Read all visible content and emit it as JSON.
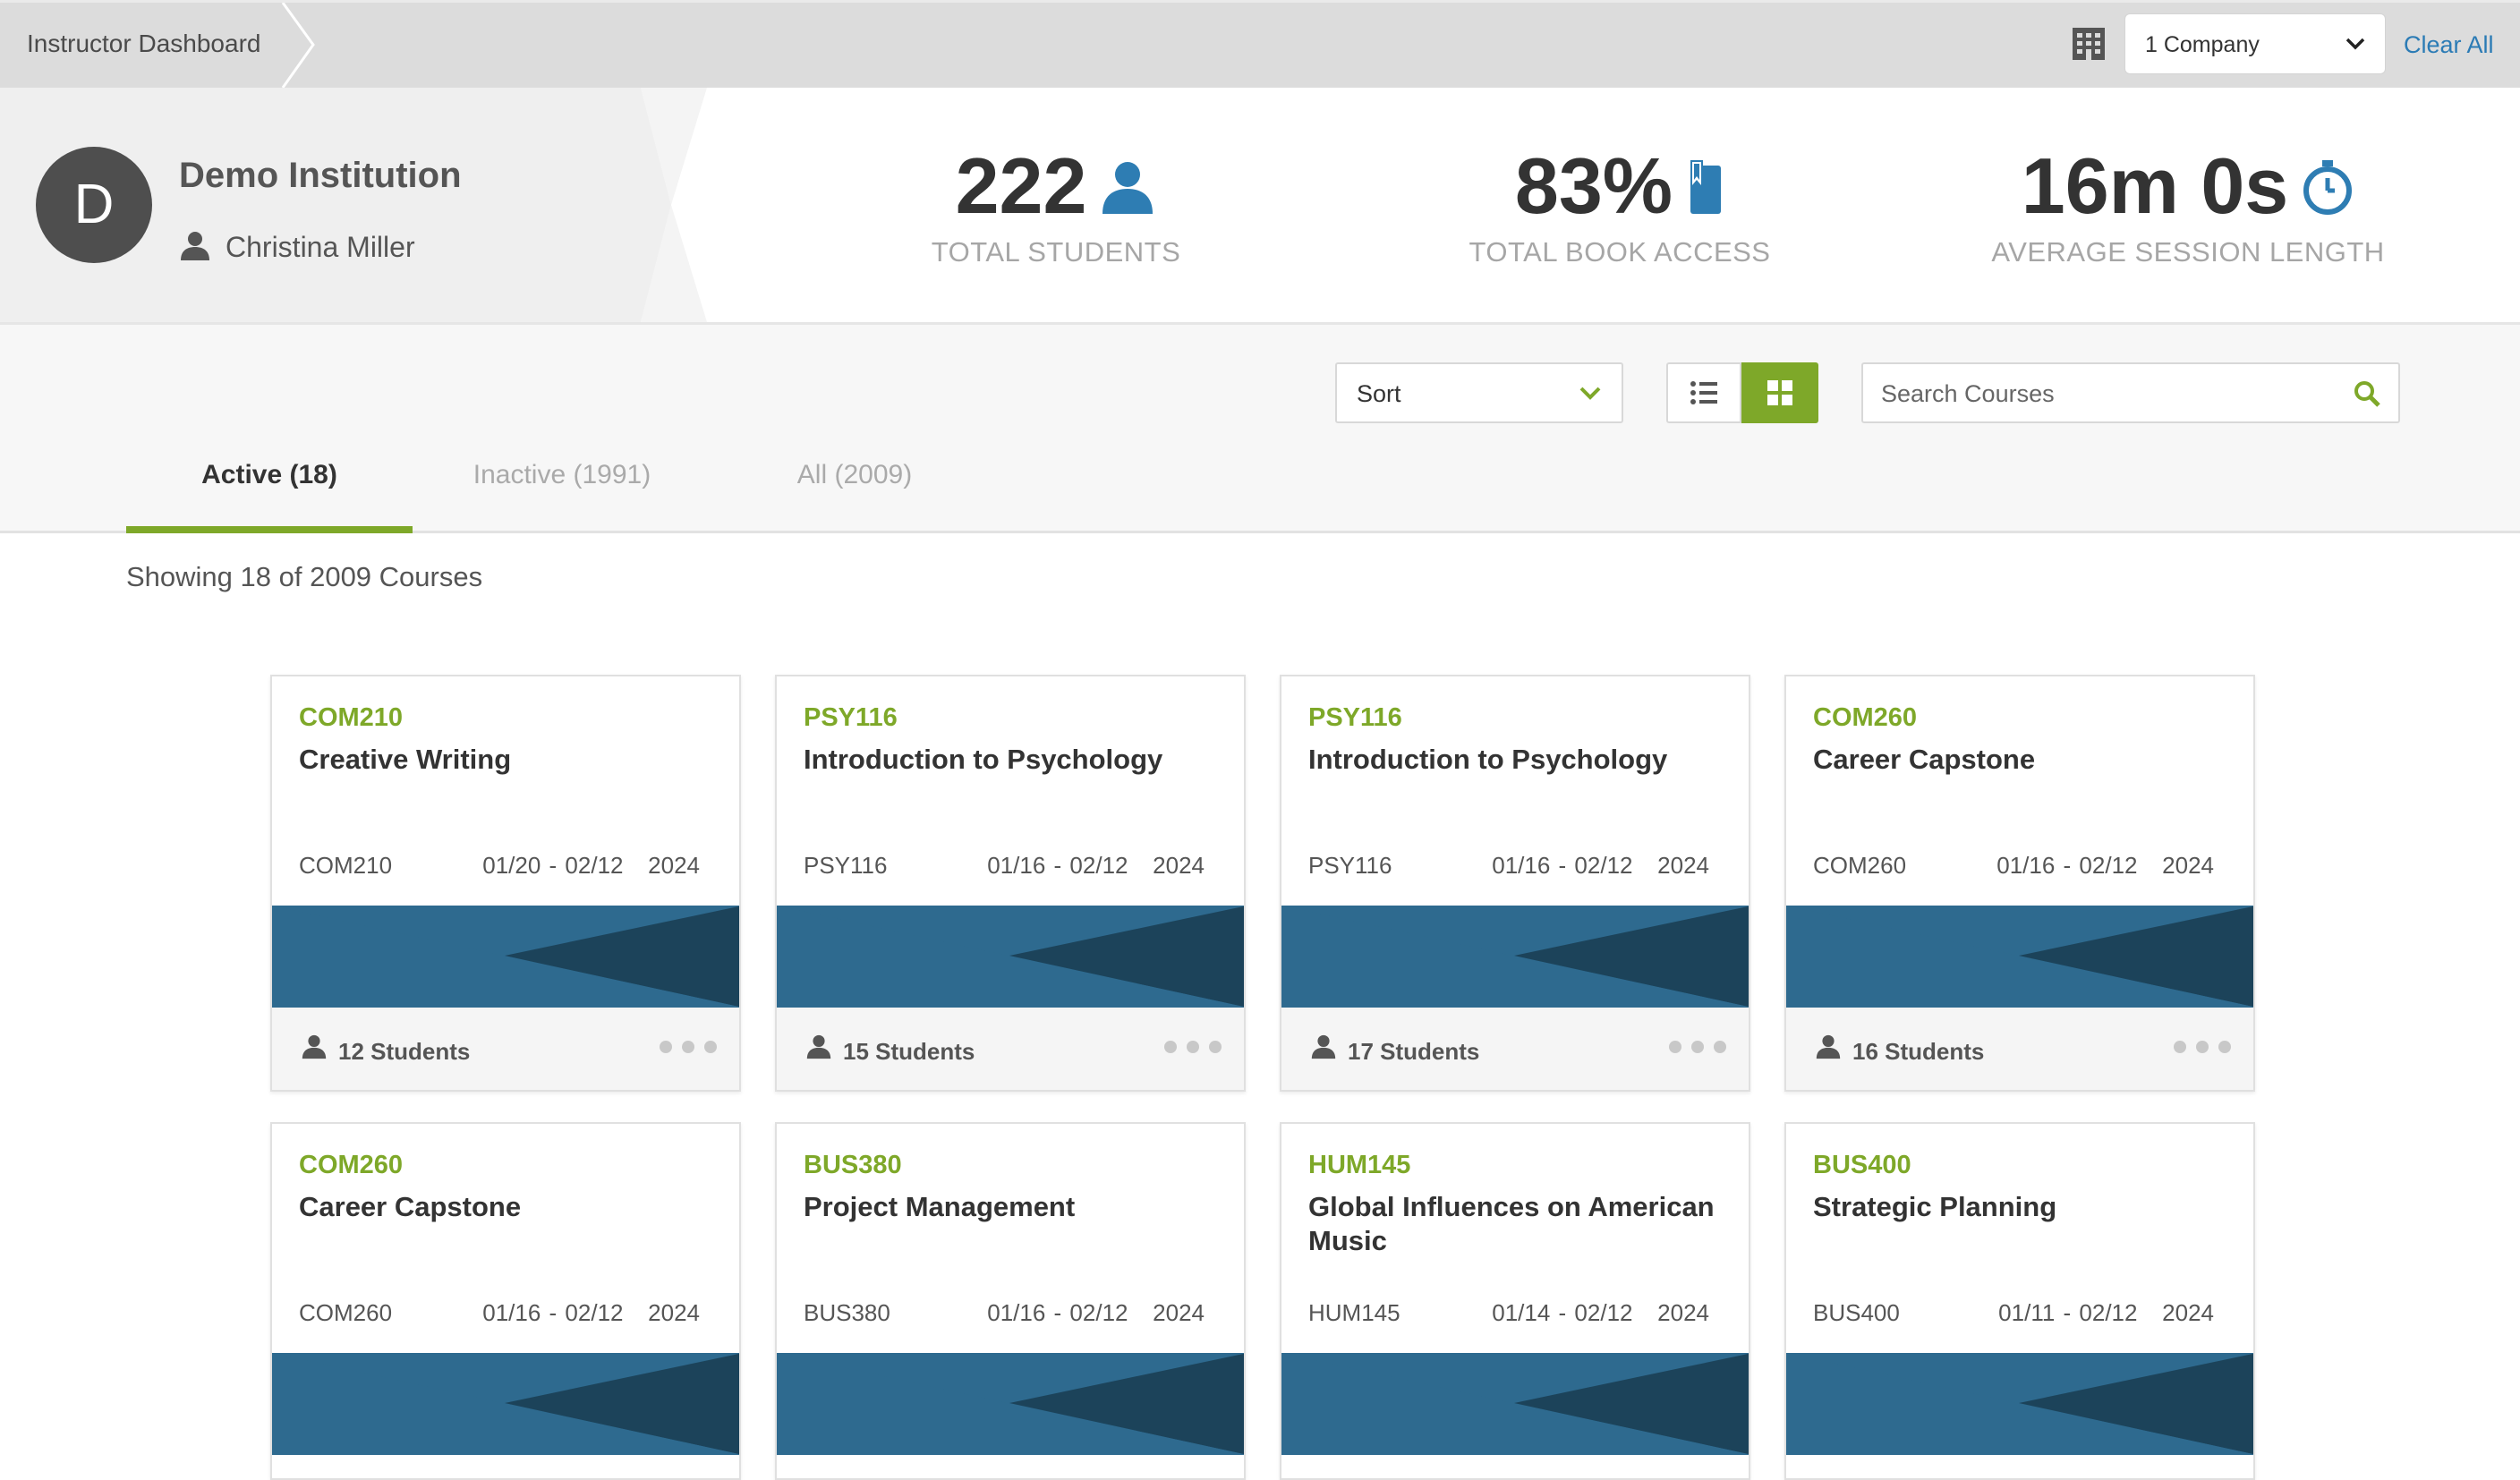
{
  "topbar": {
    "breadcrumb": "Instructor Dashboard",
    "company_select": "1 Company",
    "clear_all": "Clear All"
  },
  "profile": {
    "avatar_letter": "D",
    "institution": "Demo Institution",
    "user": "Christina Miller"
  },
  "stats": [
    {
      "value": "222",
      "label": "TOTAL STUDENTS",
      "icon": "user-icon"
    },
    {
      "value": "83%",
      "label": "TOTAL BOOK ACCESS",
      "icon": "book-icon"
    },
    {
      "value": "16m 0s",
      "label": "AVERAGE SESSION LENGTH",
      "icon": "stopwatch-icon"
    }
  ],
  "controls": {
    "sort_label": "Sort",
    "search_placeholder": "Search Courses"
  },
  "tabs": [
    {
      "label": "Active (18)",
      "active": true
    },
    {
      "label": "Inactive (1991)",
      "active": false
    },
    {
      "label": "All (2009)",
      "active": false
    }
  ],
  "showing": "Showing 18 of 2009 Courses",
  "courses": [
    {
      "code": "COM210",
      "title": "Creative Writing",
      "meta_code": "COM210",
      "dates": "01/20 - 02/12",
      "year": "2024",
      "students": "12 Students"
    },
    {
      "code": "PSY116",
      "title": "Introduction to Psychology",
      "meta_code": "PSY116",
      "dates": "01/16 - 02/12",
      "year": "2024",
      "students": "15 Students"
    },
    {
      "code": "PSY116",
      "title": "Introduction to Psychology",
      "meta_code": "PSY116",
      "dates": "01/16 - 02/12",
      "year": "2024",
      "students": "17 Students"
    },
    {
      "code": "COM260",
      "title": "Career Capstone",
      "meta_code": "COM260",
      "dates": "01/16 - 02/12",
      "year": "2024",
      "students": "16 Students"
    },
    {
      "code": "COM260",
      "title": "Career Capstone",
      "meta_code": "COM260",
      "dates": "01/16 - 02/12",
      "year": "2024",
      "students": ""
    },
    {
      "code": "BUS380",
      "title": "Project Management",
      "meta_code": "BUS380",
      "dates": "01/16 - 02/12",
      "year": "2024",
      "students": ""
    },
    {
      "code": "HUM145",
      "title": "Global Influences on American Music",
      "meta_code": "HUM145",
      "dates": "01/14 - 02/12",
      "year": "2024",
      "students": ""
    },
    {
      "code": "BUS400",
      "title": "Strategic Planning",
      "meta_code": "BUS400",
      "dates": "01/11 - 02/12",
      "year": "2024",
      "students": ""
    }
  ],
  "colors": {
    "accent_green": "#7ea829",
    "link_blue": "#2b7bb5",
    "banner_light": "#2e6a8f",
    "banner_dark": "#1c435a",
    "stat_icon_blue": "#2e7db3"
  }
}
